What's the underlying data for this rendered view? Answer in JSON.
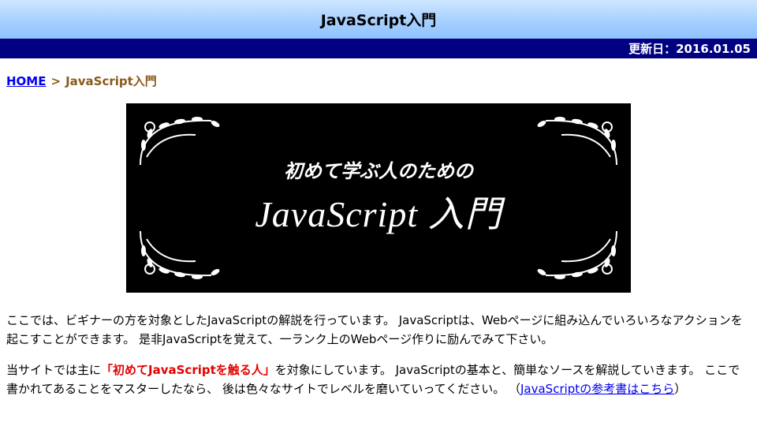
{
  "page": {
    "title": "JavaScript入門",
    "updated": "更新日：2016.01.05"
  },
  "breadcrumb": {
    "home": "HOME",
    "separator": ">",
    "current": "JavaScript入門"
  },
  "banner": {
    "subtitle": "初めて学ぶ人のための",
    "main_title": "JavaScript 入門"
  },
  "intro": {
    "paragraph1": "ここでは、ビギナーの方を対象としたJavaScriptの解説を行っています。 JavaScriptは、Webページに組み込んでいろいろなアクションを起こすことができます。 是非JavaScriptを覚えて、一ランク上のWebページ作りに励んでみて下さい。",
    "p2_before": "当サイトでは主に",
    "p2_highlight": "「初めてJavaScriptを触る人」",
    "p2_middle": "を対象にしています。 JavaScriptの基本と、簡単なソースを解説していきます。 ここで書かれてあることをマスターしたなら、 後は色々なサイトでレベルを磨いていってください。 （",
    "p2_link": "JavaScriptの参考書はこちら",
    "p2_after": "）"
  },
  "colors": {
    "header_gradient_top": "#cfe6ff",
    "header_gradient_bottom": "#8fc2ff",
    "update_bar": "#000080",
    "breadcrumb_current": "#8a5a1a",
    "highlight": "#e60000",
    "link": "#0000ee"
  }
}
